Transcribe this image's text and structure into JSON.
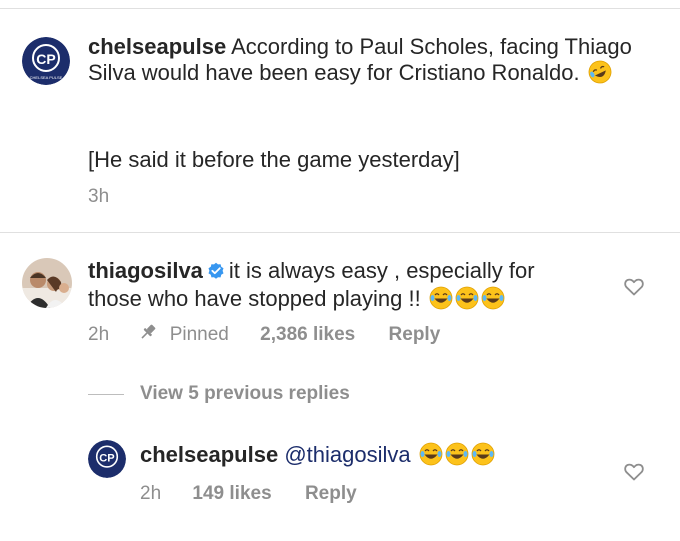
{
  "caption": {
    "username": "chelseapulse",
    "text": "According to Paul Scholes, facing Thiago Silva would have been easy for Cristiano Ronaldo.",
    "emoji": "rofl-emoji",
    "note": "[He said it before the game yesterday]",
    "time": "3h",
    "avatar_letters": "CP",
    "avatar_sub": "CHELSEA PULSE"
  },
  "comment": {
    "username": "thiagosilva",
    "verified_icon": "verified-badge-icon",
    "text_line1": "it is always easy , especially for",
    "text_line2": "those who have stopped playing !!",
    "emojis": [
      "joy-emoji",
      "joy-emoji",
      "joy-emoji"
    ],
    "time": "2h",
    "pinned_label": "Pinned",
    "likes": "2,386 likes",
    "reply_label": "Reply"
  },
  "view_replies": "View 5 previous replies",
  "reply": {
    "username": "chelseapulse",
    "mention": "@thiagosilva",
    "emojis": [
      "joy-emoji",
      "joy-emoji",
      "joy-emoji"
    ],
    "time": "2h",
    "likes": "149 likes",
    "reply_label": "Reply"
  },
  "colors": {
    "accent_blue": "#1c2d6b",
    "verified": "#3897f0",
    "muted": "#8e8e8e"
  }
}
